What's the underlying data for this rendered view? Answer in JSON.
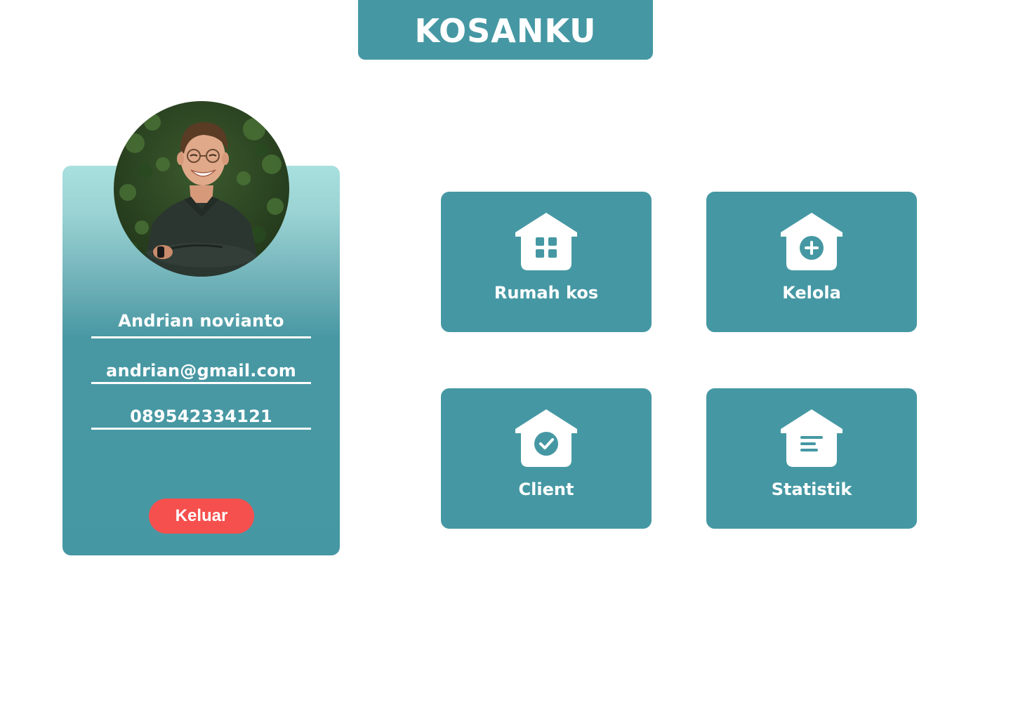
{
  "header": {
    "title": "KOSANKU"
  },
  "profile": {
    "name": "Andrian novianto",
    "email": "andrian@gmail.com",
    "phone": "089542334121",
    "logout_label": "Keluar"
  },
  "menu": {
    "tiles": [
      {
        "label": "Rumah kos",
        "icon": "house-grid-icon"
      },
      {
        "label": "Kelola",
        "icon": "house-plus-icon"
      },
      {
        "label": "Client",
        "icon": "house-check-icon"
      },
      {
        "label": "Statistik",
        "icon": "house-list-icon"
      }
    ]
  },
  "colors": {
    "primary": "#4598a3",
    "gradient_top": "#a8e0df",
    "logout": "#f5504e",
    "text_on_primary": "#ffffff"
  }
}
